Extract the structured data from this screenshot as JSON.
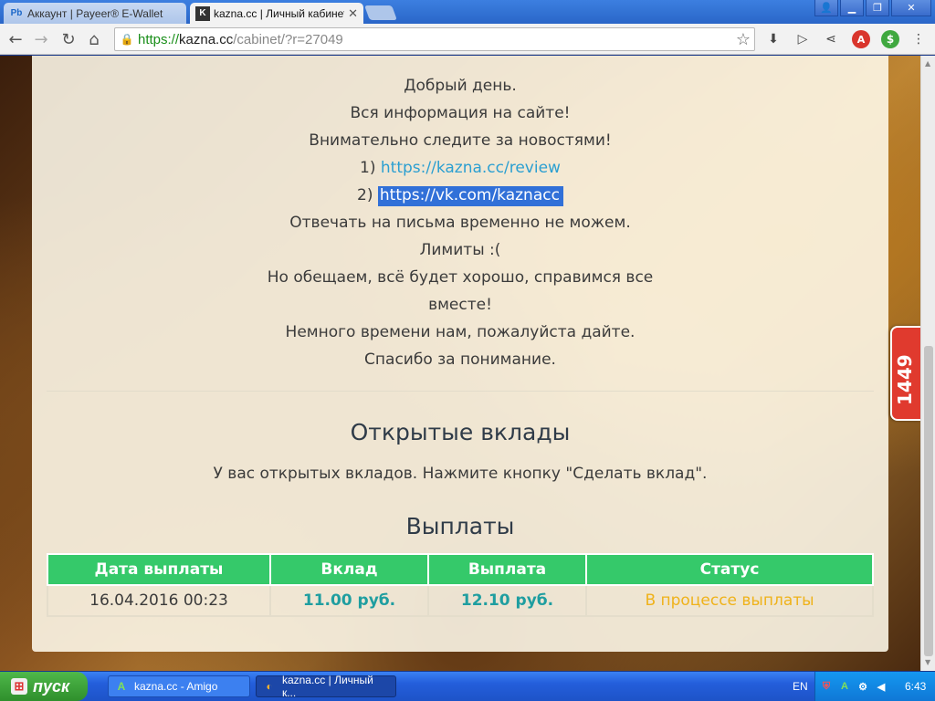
{
  "browser": {
    "tabs": [
      {
        "favicon": "Pb",
        "title": "Аккаунт | Payeer® E-Wallet",
        "active": false
      },
      {
        "favicon": "K",
        "title": "kazna.cc | Личный кабинет",
        "active": true
      }
    ],
    "url": {
      "scheme": "https://",
      "host": "kazna.cc",
      "path": "/cabinet/?r=27049"
    },
    "icons": {
      "back": "back-arrow-icon",
      "forward": "forward-arrow-icon",
      "reload": "reload-icon",
      "home": "home-icon",
      "lock": "lock-icon",
      "star": "star-icon"
    }
  },
  "message": {
    "line1": "Добрый день.",
    "line2": "Вся информация на сайте!",
    "line3": "Внимательно следите за новостями!",
    "link1_prefix": "1)",
    "link1": "https://kazna.cc/review",
    "link2_prefix": "2)",
    "link2": "https://vk.com/kaznacc",
    "line4": "Отвечать на письма временно не можем.",
    "line5": "Лимиты :(",
    "line6": "Но обещаем, всё будет хорошо, справимся все",
    "line7": "вместе!",
    "line8": "Немного времени нам, пожалуйста дайте.",
    "line9": "Спасибо за понимание."
  },
  "deposits": {
    "title": "Открытые вклады",
    "text": "У вас открытых вкладов. Нажмите кнопку \"Сделать вклад\"."
  },
  "payouts": {
    "title": "Выплаты",
    "columns": [
      "Дата выплаты",
      "Вклад",
      "Выплата",
      "Статус"
    ],
    "rows": [
      {
        "date": "16.04.2016 00:23",
        "deposit": "11.00 руб.",
        "payout": "12.10 руб.",
        "status": "В процессе выплаты"
      }
    ]
  },
  "side_badge": {
    "count": "1449"
  },
  "taskbar": {
    "start_label": "пуск",
    "items": [
      {
        "label": "kazna.cc - Amigo",
        "pressed": false
      },
      {
        "label": "kazna.cc | Личный к...",
        "pressed": true
      }
    ],
    "language": "EN",
    "clock": "6:43"
  },
  "colors": {
    "table_header": "#35c96a",
    "amount": "#1f9ea0",
    "status_pending": "#efb21a",
    "link": "#2b9fd1",
    "badge": "#e03a2e"
  }
}
